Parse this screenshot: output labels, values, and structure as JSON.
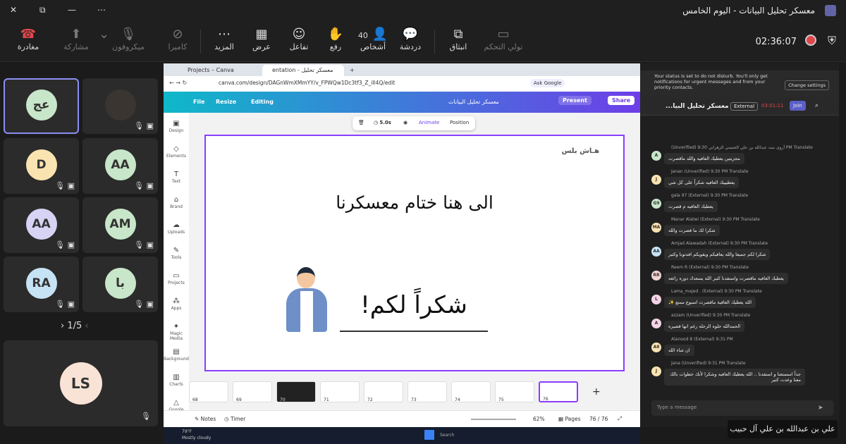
{
  "window": {
    "title": "معسكر تحليل البيانات - اليوم الخامس",
    "close": "✕",
    "restore": "⧉",
    "minimize": "—",
    "more": "⋯"
  },
  "toolbar": {
    "leave": "مغادرة",
    "share": "مشاركة",
    "mic": "ميكروفون",
    "camera": "كاميرا",
    "more": "المزيد",
    "view": "عرض",
    "react": "تفاعل",
    "raise": "رفع",
    "people_count": "40",
    "people": "أشخاص",
    "chat": "دردشة",
    "popout": "انبثاق",
    "take_control": "تولي التحكم",
    "timer": "02:36:07"
  },
  "tiles": [
    {
      "initials": "عج",
      "color": "#c8e6c9"
    },
    {
      "initials": "",
      "color": "#444"
    },
    {
      "initials": "D",
      "color": "#f9e3b0"
    },
    {
      "initials": "AA",
      "color": "#c8e6c9"
    },
    {
      "initials": "AA",
      "color": "#d6d3f5"
    },
    {
      "initials": "AM",
      "color": "#c8e6c9"
    },
    {
      "initials": "RA",
      "color": "#c6e3f5"
    },
    {
      "initials": "با",
      "color": "#c8e6c9"
    }
  ],
  "pager": "1/5",
  "self_tile": {
    "initials": "LS",
    "color": "#f9e3d6"
  },
  "browser": {
    "tab1": "Projects – Canva",
    "tab2": "entation - معسكر تحليل البيانات",
    "url": "canva.com/design/DAGnWmXMmYY/v_FPWQw1Dc3tf3_Z_iIl4Q/edit",
    "ask": "Ask Google"
  },
  "canva": {
    "file": "File",
    "resize": "Resize",
    "editing": "Editing",
    "doc_title": "معسكر تحليل البيانات",
    "present": "Present",
    "share": "Share",
    "side": [
      "Design",
      "Elements",
      "Text",
      "Brand",
      "Uploads",
      "Tools",
      "Projects",
      "Apps",
      "Magic Media",
      "Background",
      "Charts",
      "Google Drive"
    ],
    "ctx_duration": "5.0s",
    "ctx_animate": "Animate",
    "ctx_position": "Position",
    "slide_brand": "هـاش بلس",
    "slide_heading": "الى هنا ختام معسكرنا",
    "slide_thanks": "شكراً لكم!",
    "thumb_nums": [
      "68",
      "69",
      "70",
      "71",
      "72",
      "73",
      "74",
      "75",
      "76"
    ],
    "notes": "Notes",
    "timer": "Timer",
    "zoom": "62%",
    "pages": "Pages",
    "page_count": "76 / 76"
  },
  "taskbar": {
    "weather": "79°F",
    "weather_desc": "Mostly cloudy",
    "search": "Search"
  },
  "chat": {
    "dnd": "Your status is set to do not disturb. You'll only get notifications for urgent messages and from your priority contacts.",
    "change": "Change settings",
    "title": "معسكر تحليل البيا...",
    "external": "External",
    "call_time": "03:01:11",
    "join": "Join",
    "messages": [
      {
        "who": "(Unverified) أروى بنت عبدالله بن علي الحسني الزهراني 9:30 PM  Translate",
        "text": "مجزيتين يعطيك العافيه والله ماقصرت",
        "d": "A",
        "c": "#c8e6c9"
      },
      {
        "who": "Janan (Unverified) 9:30 PM  Translate",
        "text": "يعطيييك العافيه شكراً على كل شي",
        "d": "J",
        "c": "#f9e3b0"
      },
      {
        "who": "gala 97 (External) 9:30 PM  Translate",
        "text": "يعطيك العافيه م قصرت",
        "d": "G9",
        "c": "#c8e6c9"
      },
      {
        "who": "Manar Alatwi (External) 9:30 PM  Translate",
        "text": "شكرا لك ما قصرت والله",
        "d": "MA",
        "c": "#f9e3b0"
      },
      {
        "who": "Amjad Alawadah (External) 9:30 PM  Translate",
        "text": "شكرا لكم جميعا والله يعافيكم ويقويكم افدتونا وكثير",
        "d": "AA",
        "c": "#c6e3f5"
      },
      {
        "who": "Reem R (External) 9:30 PM  Translate",
        "text": "يعطيك العافيه ماقصرت واستفدنا كثير الله يسعدك دوره رائعه",
        "d": "RR",
        "c": "#f5d3d3"
      },
      {
        "who": "Lama_majed . (External) 9:30 PM  Translate",
        "text": "الله يعطيك العافية ماقصرت اسبوع ممتع ✨",
        "d": "L",
        "c": "#f5d3e6"
      },
      {
        "who": "azzam (Unverified) 9:30 PM  Translate",
        "text": "الحمدالله حلوه الرحله رغم انها قصيره",
        "d": "A",
        "c": "#f5d3e6"
      },
      {
        "who": "Alanood 8 (External) 9:31 PM",
        "text": "ان شاء الله",
        "d": "A8",
        "c": "#f9e3b0"
      },
      {
        "who": "Jana (Unverified) 9:31 PM  Translate",
        "text": "جداً استمتعنا و استفدنا .. الله يعطيك العافيه وشكرا لأنك خطوات بالك معنا وعدت كثير",
        "d": "J",
        "c": "#f9e3b0"
      }
    ],
    "input_placeholder": "Type a message"
  },
  "caption": "علي بن عبدالله بن علي آل حبيب"
}
